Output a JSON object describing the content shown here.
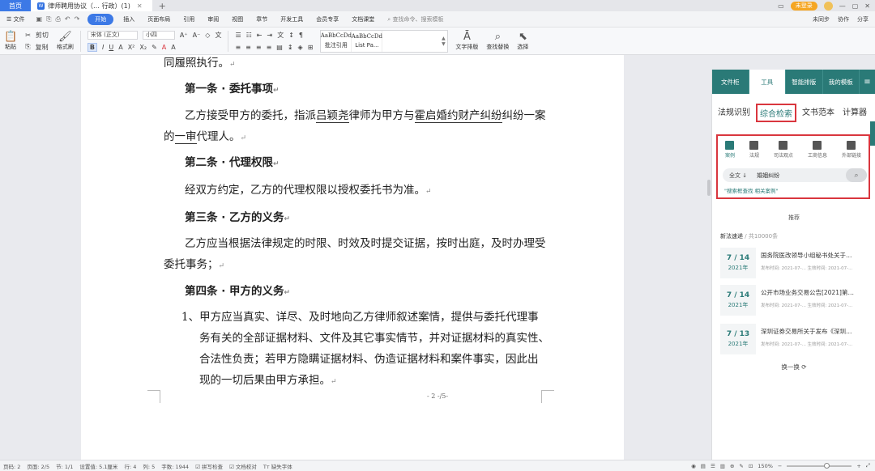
{
  "titlebar": {
    "home_tab": "首页",
    "doc_tab": "律师聘用协议（… 行政）(1)",
    "add_tab": "+",
    "login_label": "未登录",
    "right_icons": [
      "▭",
      "—",
      "▢",
      "✕"
    ]
  },
  "menubar": {
    "file_label": "文件",
    "items": [
      "开始",
      "插入",
      "页面布局",
      "引用",
      "审阅",
      "视图",
      "章节",
      "开发工具",
      "会员专享",
      "文档课堂"
    ],
    "search_placeholder": "查找命令、搜索模板",
    "right_items": [
      "未同步",
      "协作",
      "分享"
    ]
  },
  "ribbon": {
    "paste_label": "粘贴",
    "cut_label": "剪切",
    "copy_label": "复制",
    "format_brush_label": "格式刷",
    "font_name": "宋体 (正文)",
    "font_size": "小四",
    "styles": [
      {
        "sample": "AaBbCcDd",
        "name": "批注引用"
      },
      {
        "sample": "AaBbCcDd",
        "name": "List Pa..."
      }
    ],
    "text_layout_label": "文字排版",
    "find_replace_label": "查找替换",
    "select_label": "选择"
  },
  "document": {
    "lines": [
      "同履照执行。",
      "第一条",
      "委托事项",
      "乙方接受甲方的委托，指派",
      "吕颖尧",
      "律师为甲方与",
      "霍启婚约财产纠纷",
      "纠纷一案",
      "的",
      "一审",
      "代理人。",
      "第二条",
      "代理权限",
      "经双方约定，乙方的代理权限以授权委托书为准。",
      "第三条",
      "乙方的义务",
      "乙方应当根据法律规定的时限、时效及时提交证据，按时出庭，及时办理受",
      "委托事务；",
      "第四条",
      "甲方的义务",
      "1、甲方应当真实、详尽、及时地向乙方律师叙述案情，提供与委托代理事",
      "务有关的全部证据材料、文件及其它事实情节，并对证据材料的真实性、",
      "合法性负责；若甲方隐瞒证据材料、伪造证据材料和案件事实，因此出",
      "现的一切后果由甲方承担。"
    ],
    "page_number": "- 2 -/5-"
  },
  "panel": {
    "tabs": [
      "文件柜",
      "工具",
      "智能排版",
      "我的模板"
    ],
    "active_tab": 1,
    "subtabs": [
      "法规识别",
      "综合检索",
      "文书范本",
      "计算器"
    ],
    "categories": [
      "案例",
      "法规",
      "司法观点",
      "工商信息",
      "外部链接"
    ],
    "search_scope": "全文",
    "search_value": "婚姻纠纷",
    "hint": "\"搜索框查找 相关案例\"",
    "recommend_label": "推荐",
    "new_law_label": "新法速递",
    "new_law_count": "/ 共10000条",
    "news": [
      {
        "date": "7 / 14",
        "year": "2021年",
        "title": "国务院医改领导小组秘书处关于…",
        "meta": "发布时间: 2021-07-...  生效时间: 2021-07-..."
      },
      {
        "date": "7 / 14",
        "year": "2021年",
        "title": "公开市场业务交易公告[2021]第…",
        "meta": "发布时间: 2021-07-...  生效时间: 2021-07-..."
      },
      {
        "date": "7 / 13",
        "year": "2021年",
        "title": "深圳证券交易所关于发布《深圳…",
        "meta": "发布时间: 2021-07-...  生效时间: 2021-07-..."
      }
    ],
    "refresh_label": "换一换"
  },
  "statusbar": {
    "items": [
      "页码: 2",
      "页面: 2/5",
      "节: 1/1",
      "设置值: 5.1厘米",
      "行: 4",
      "列: 5",
      "字数: 1944",
      "拼写检查",
      "文档校对",
      "缺失字体"
    ],
    "zoom": "150%"
  },
  "colors": {
    "accent": "#3c79e6",
    "panel_teal": "#2a7a77",
    "highlight_red": "#d9363e"
  }
}
